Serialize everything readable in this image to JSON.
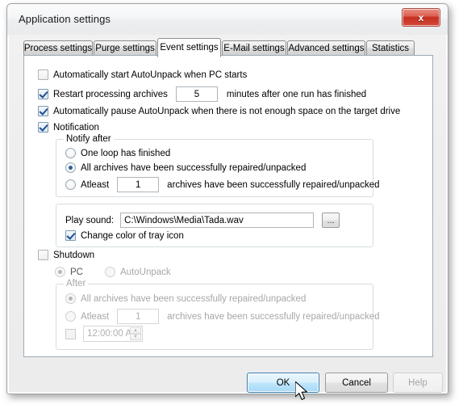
{
  "window": {
    "title": "Application settings",
    "close_label": "x"
  },
  "tabs": [
    {
      "label": "Process settings",
      "active": false
    },
    {
      "label": "Purge settings",
      "active": false
    },
    {
      "label": "Event settings",
      "active": true
    },
    {
      "label": "E-Mail settings",
      "active": false
    },
    {
      "label": "Advanced settings",
      "active": false
    },
    {
      "label": "Statistics",
      "active": false
    }
  ],
  "event_settings": {
    "autostart": {
      "label": "Automatically start AutoUnpack when PC starts",
      "checked": false
    },
    "restart": {
      "label_before": "Restart processing archives",
      "value": "5",
      "label_after": "minutes after one run has finished",
      "checked": true
    },
    "autopause": {
      "label": "Automatically pause AutoUnpack when there is not enough space on the target drive",
      "checked": true
    },
    "notification": {
      "label": "Notification",
      "checked": true
    },
    "notify_after": {
      "title": "Notify after",
      "options": [
        {
          "label": "One loop has finished",
          "selected": false
        },
        {
          "label": "All archives have been successfully repaired/unpacked",
          "selected": true
        },
        {
          "label": "Atleast",
          "selected": false,
          "value": "1",
          "suffix": "archives have been successfully repaired/unpacked"
        }
      ]
    },
    "sound": {
      "label": "Play sound:",
      "path": "C:\\Windows\\Media\\Tada.wav",
      "browse_label": "...",
      "tray_icon": {
        "label": "Change color of tray icon",
        "checked": true
      }
    },
    "shutdown": {
      "label": "Shutdown",
      "checked": false,
      "targets": [
        {
          "label": "PC",
          "selected": true
        },
        {
          "label": "AutoUnpack",
          "selected": false
        }
      ],
      "after": {
        "title": "After",
        "options": [
          {
            "label": "All archives have been successfully repaired/unpacked",
            "selected": true
          },
          {
            "label": "Atleast",
            "selected": false,
            "value": "1",
            "suffix": "archives have been successfully repaired/unpacked"
          }
        ],
        "time": {
          "checked": false,
          "value": "12:00:00 A"
        }
      }
    }
  },
  "footer": {
    "ok_label": "OK",
    "cancel_label": "Cancel",
    "help_label": "Help"
  }
}
